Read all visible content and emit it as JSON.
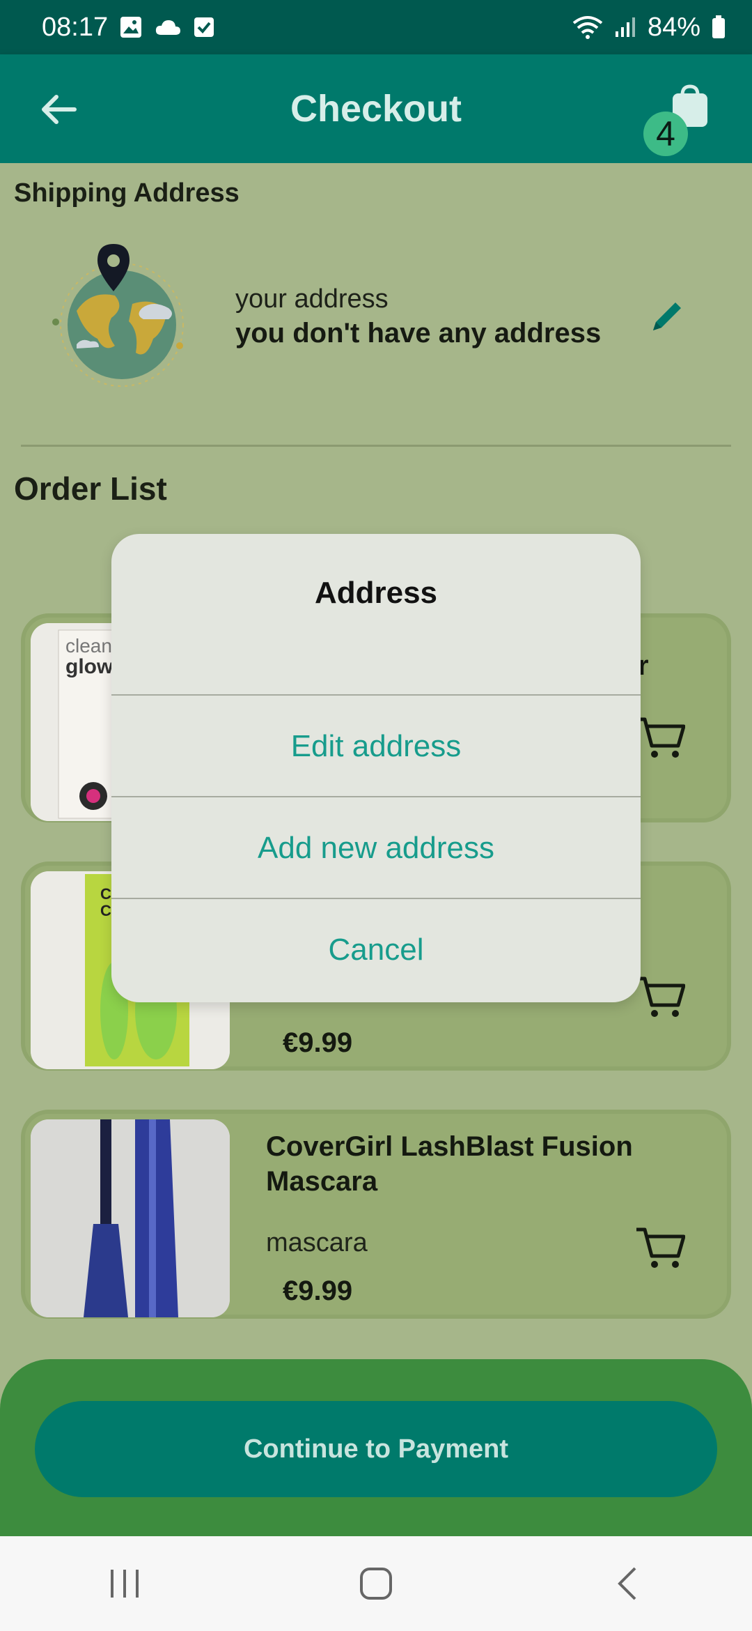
{
  "status_bar": {
    "time": "08:17",
    "battery": "84%"
  },
  "app_bar": {
    "title": "Checkout",
    "cart_count": "4"
  },
  "shipping": {
    "section_title": "Shipping Address",
    "label": "your address",
    "value": "you don't have any address"
  },
  "orders": {
    "section_title": "Order List",
    "items": [
      {
        "name_visible_tail": "r",
        "category": "",
        "price": ""
      },
      {
        "name": "",
        "category": "",
        "price": "€9.99"
      },
      {
        "name": "CoverGirl LashBlast Fusion Mascara",
        "category": "mascara",
        "price": "€9.99"
      }
    ]
  },
  "footer": {
    "pay_label": "Continue to Payment"
  },
  "dialog": {
    "title": "Address",
    "options": [
      "Edit address",
      "Add new address",
      "Cancel"
    ]
  },
  "colors": {
    "primary": "#00796b",
    "accent": "#179c8c",
    "badge": "#3dbb87",
    "panel": "#3d8c3e"
  }
}
